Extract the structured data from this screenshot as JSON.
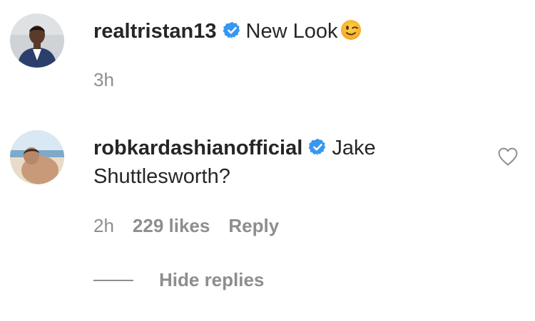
{
  "comments": [
    {
      "username": "realtristan13",
      "verified": true,
      "text": "New Look",
      "emoji": "winking-face",
      "time": "3h",
      "likes": "",
      "reply_label": ""
    },
    {
      "username": "robkardashianofficial",
      "verified": true,
      "text_line1": "Jake",
      "text_line2": "Shuttlesworth?",
      "time": "2h",
      "likes": "229 likes",
      "reply_label": "Reply"
    }
  ],
  "replies_toggle": {
    "label": "Hide replies"
  },
  "colors": {
    "text": "#262626",
    "secondary": "#8e8e8e",
    "verified": "#3897f0"
  },
  "icons": {
    "verified": "verified-badge-icon",
    "like": "heart-outline-icon",
    "emoji": "winking-face-emoji"
  }
}
